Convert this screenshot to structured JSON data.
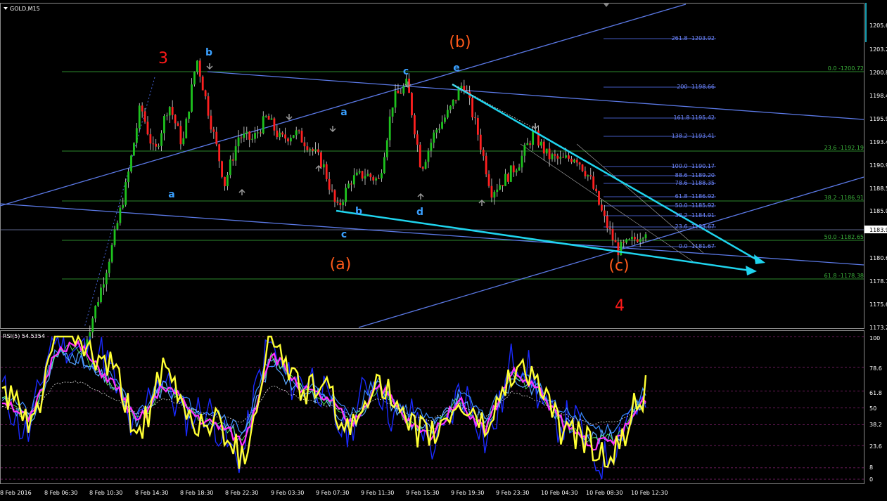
{
  "window": {
    "title": "GOLD,M15"
  },
  "indicator": {
    "title": "RSI(5) 54.5354"
  },
  "colors": {
    "bull": "#1ec21e",
    "bear": "#ff2020",
    "wick": "#ffffff",
    "fibo_blue": "#5a78ff",
    "fibo_green": "#3cb43c",
    "channel": "#5b79e6",
    "cyan": "#1fd4ee",
    "wave_red": "#ff1a1a",
    "wave_orange": "#ff5a1a",
    "wave_blue": "#3aa0ff",
    "rsi_yellow": "#ffff33",
    "rsi_magenta": "#ff33ff",
    "rsi_blue": "#1a2aff",
    "grid": "#1c2a1c"
  },
  "price_axis": {
    "ticks": [
      "1205.6",
      "1203.2",
      "1200.8",
      "1198.4",
      "1195.9",
      "1193.4",
      "1190.9",
      "1188.5",
      "1185.0",
      "1183.0",
      "1180.6",
      "1178.1",
      "1175.6",
      "1173.2"
    ],
    "current": "1183.9"
  },
  "rsi_axis": {
    "ticks": [
      "100",
      "78.6",
      "61.8",
      "50",
      "38.2",
      "23.6",
      "8",
      "0"
    ]
  },
  "time_axis": {
    "ticks": [
      "8 Feb 2016",
      "8 Feb 06:30",
      "8 Feb 10:30",
      "8 Feb 14:30",
      "8 Feb 18:30",
      "8 Feb 22:30",
      "9 Feb 03:30",
      "9 Feb 07:30",
      "9 Feb 11:30",
      "9 Feb 15:30",
      "9 Feb 19:30",
      "9 Feb 23:30",
      "10 Feb 04:30",
      "10 Feb 08:30",
      "10 Feb 12:30"
    ]
  },
  "fibo_expansion": [
    "261.8 -1203.92",
    "200- 1198.66",
    "161.8 1195.42",
    "138.2 -1193.41",
    "100.0 -1190.17",
    "88.6 -1189.20",
    "78.6 -1188.35",
    "61.8 -1186.92",
    "50.0 -1185.92",
    "38.2 -1184.91",
    "23.6 -1183.67",
    "0.0 -1181.67"
  ],
  "fibo_retracement": [
    "0.0 -1200.72",
    "23.6 -1192.19",
    "38.2 -1186.91",
    "50.0 -1182.65",
    "61.8 -1178.38"
  ],
  "wave_labels": {
    "w3": "3",
    "w4": "4",
    "wa": "(a)",
    "wb": "(b)",
    "wc": "(c)",
    "b1": "b",
    "a1": "a",
    "c1": "c",
    "a2": "a",
    "b2": "b",
    "c2": "c",
    "d2": "d",
    "e2": "e"
  },
  "chart_data": {
    "type": "candlestick",
    "title": "GOLD,M15",
    "y_range": [
      1172.8,
      1207.0
    ],
    "x_range": [
      "8 Feb 2016",
      "10 Feb 12:30"
    ],
    "close_path": [
      1171.0,
      1176.0,
      1181.5,
      1188.0,
      1196.2,
      1191.0,
      1196.5,
      1192.0,
      1201.2,
      1194.5,
      1188.0,
      1193.0,
      1192.6,
      1195.0,
      1192.6,
      1193.4,
      1192.0,
      1190.0,
      1185.2,
      1188.4,
      1189.0,
      1188.3,
      1196.8,
      1198.5,
      1189.6,
      1193.5,
      1195.6,
      1198.7,
      1193.5,
      1187.2,
      1188.5,
      1190.3,
      1193.3,
      1190.9,
      1190.4,
      1190.9,
      1188.6,
      1184.4,
      1181.0,
      1181.9,
      1183.2
    ],
    "rsi_levels": [
      100,
      78.6,
      61.8,
      50,
      38.2,
      23.6,
      8,
      0
    ],
    "grid": false
  }
}
